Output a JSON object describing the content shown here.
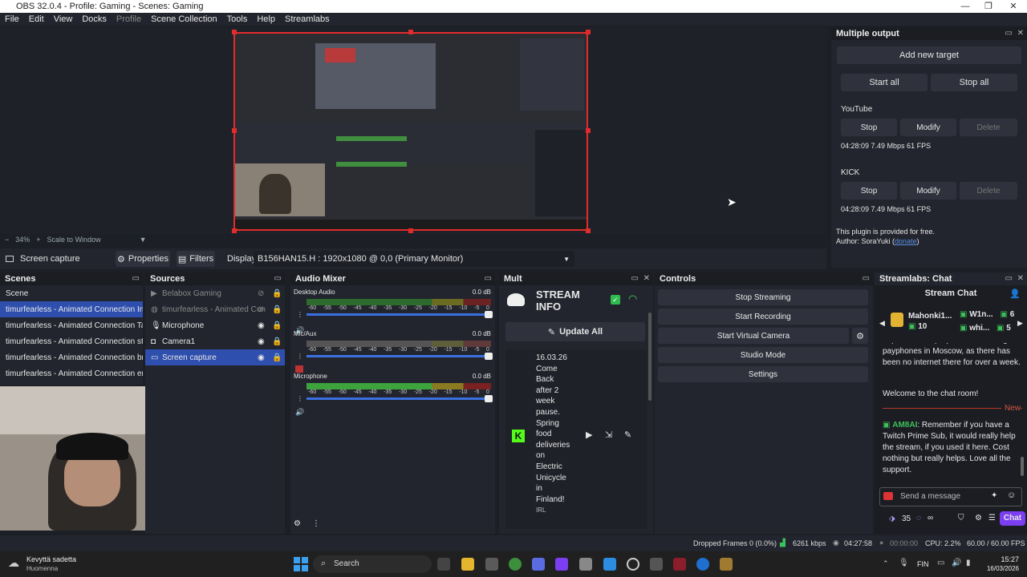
{
  "window": {
    "title": "OBS 32.0.4 - Profile: Gaming - Scenes: Gaming"
  },
  "menu": [
    "File",
    "Edit",
    "View",
    "Docks",
    "Profile",
    "Scene Collection",
    "Tools",
    "Help",
    "Streamlabs"
  ],
  "preview": {
    "zoom": "34%",
    "scale_mode": "Scale to Window"
  },
  "source_bar": {
    "selected_source": "Screen capture",
    "properties": "Properties",
    "filters": "Filters",
    "display_label": "Display",
    "display_value": "B156HAN15.H : 1920x1080 @ 0,0 (Primary Monitor)"
  },
  "multiple_output": {
    "title": "Multiple output",
    "add_target": "Add new target",
    "start_all": "Start all",
    "stop_all": "Stop all",
    "targets": [
      {
        "name": "YouTube",
        "stop": "Stop",
        "modify": "Modify",
        "delete": "Delete",
        "stats": "04:28:09  7.49 Mbps  61 FPS"
      },
      {
        "name": "KICK",
        "stop": "Stop",
        "modify": "Modify",
        "delete": "Delete",
        "stats": "04:28:09  7.49 Mbps  61 FPS"
      }
    ],
    "footer1": "This plugin is provided for free.",
    "footer2": "Author: SoraYuki (",
    "donate": "donate",
    "footer_close": ")"
  },
  "scenes": {
    "title": "Scenes",
    "items": [
      "Scene",
      "timurfearless - Animated Connection In ga",
      "timurfearless - Animated Connection Talk s",
      "timurfearless - Animated Connection start",
      "timurfearless - Animated Connection brb s",
      "timurfearless - Animated Connection end s"
    ]
  },
  "sources": {
    "title": "Sources",
    "items": [
      "Belabox Gaming",
      "timurfearless - Animated Con",
      "Microphone",
      "Camera1",
      "Screen capture"
    ]
  },
  "audio_mixer": {
    "title": "Audio Mixer",
    "channels": [
      {
        "name": "Desktop Audio",
        "db": "0.0 dB"
      },
      {
        "name": "Mic/Aux",
        "db": "0.0 dB"
      },
      {
        "name": "Microphone",
        "db": "0.0 dB"
      }
    ],
    "scale": [
      "-60",
      "-55",
      "-50",
      "-45",
      "-40",
      "-35",
      "-30",
      "-25",
      "-20",
      "-15",
      "-10",
      "-5",
      "0"
    ]
  },
  "mult": {
    "title": "Mult",
    "stream_info_line1": "STREAM",
    "stream_info_line2": "INFO",
    "update_all": "Update All",
    "stream_title_lines": [
      "16.03.26",
      "Come",
      "Back",
      "after 2",
      "week",
      "pause.",
      "Spring",
      "food",
      "deliveries",
      "on",
      "Electric",
      "Unicycle",
      "in",
      "Finland!"
    ],
    "category": "IRL"
  },
  "controls": {
    "title": "Controls",
    "buttons": [
      "Stop Streaming",
      "Start Recording",
      "Start Virtual Camera",
      "Studio Mode",
      "Settings"
    ]
  },
  "chat": {
    "title": "Streamlabs: Chat",
    "header": "Stream Chat",
    "top_user": "Mahonki1...",
    "top_user_count": "10",
    "user2": "W1n...",
    "user2_count": "6",
    "user3": "whi...",
    "user3_count": "5",
    "msg_partial": "depaties have proposed reinstating payphones in Moscow, as there has been no internet there for over a week.",
    "welcome": "Welcome to the chat room!",
    "new_label": "New",
    "author": "AM8AI",
    "message": "Remember if you have a Twitch Prime Sub, it would really help the stream, if you used it here. Cost nothing but really helps. Love all the support.",
    "placeholder": "Send a message",
    "points": "35",
    "chat_button": "Chat"
  },
  "status": {
    "dropped": "Dropped Frames 0 (0.0%)",
    "kbps": "6261 kbps",
    "live_time": "04:27:58",
    "rec_time": "00:00:00",
    "cpu": "CPU: 2.2%",
    "fps": "60.00 / 60.00 FPS"
  },
  "taskbar": {
    "weather_title": "Kevyttä sadetta",
    "weather_sub": "Huomenna",
    "search": "Search",
    "lang": "FIN",
    "time": "15:27",
    "date": "16/03/2026"
  },
  "colors": {
    "accent": "#2e4fae",
    "selection_red": "#e12c2c",
    "chat_button": "#7b3ef0"
  }
}
